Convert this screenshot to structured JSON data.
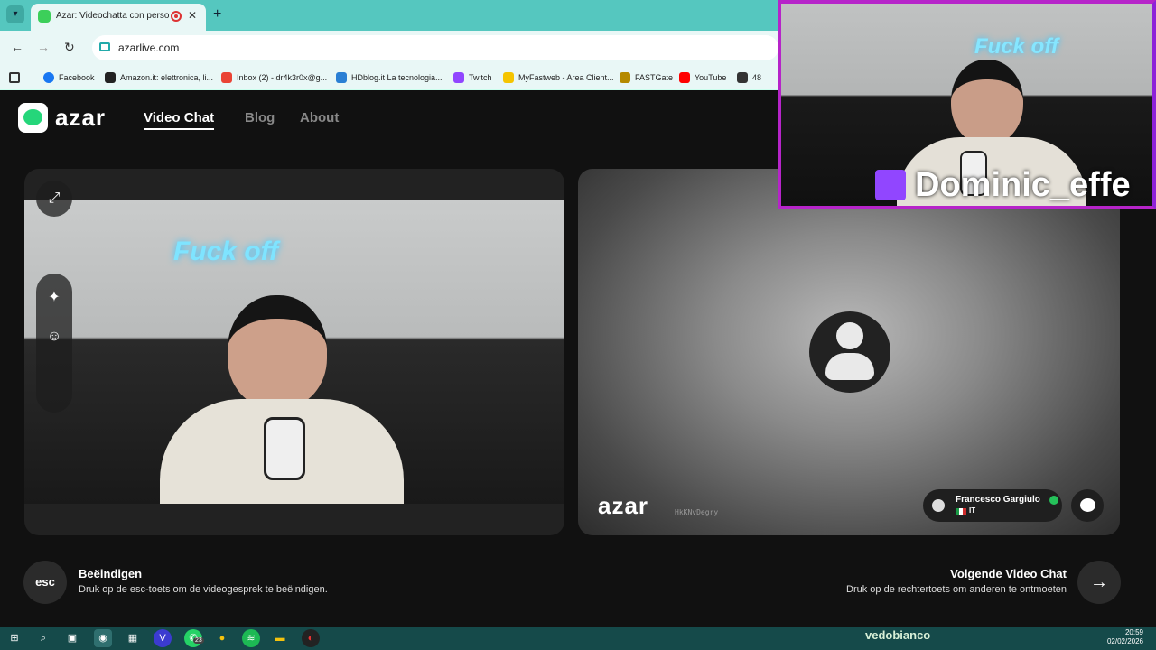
{
  "browser": {
    "tab_title": "Azar: Videochatta con persone n",
    "tab_close": "✕",
    "new_tab": "+",
    "url": "azarlive.com",
    "nav_back": "←",
    "nav_forward": "→",
    "nav_reload": "↻",
    "bookmarks": [
      {
        "label": "Facebook",
        "color": "#1877f2"
      },
      {
        "label": "Amazon.it: elettronica, li...",
        "color": "#222222"
      },
      {
        "label": "Inbox (2) - dr4k3r0x@g...",
        "color": "#ea4335"
      },
      {
        "label": "HDblog.it La tecnologia...",
        "color": "#2a7fd4"
      },
      {
        "label": "Twitch",
        "color": "#9146ff"
      },
      {
        "label": "MyFastweb - Area Client...",
        "color": "#f5c400"
      },
      {
        "label": "FASTGate",
        "color": "#b58a00"
      },
      {
        "label": "YouTube",
        "color": "#ff0000"
      },
      {
        "label": "48",
        "color": "#333333"
      }
    ]
  },
  "azar": {
    "logo_text": "azar",
    "nav": [
      "Video Chat",
      "Blog",
      "About"
    ],
    "neon_text": "Fuck off",
    "watermark": "azar",
    "peer_id": "HkKNvDegry",
    "user_name": "Francesco Gargiulo",
    "country_code": "IT",
    "end": {
      "key": "esc",
      "title": "Beëindigen",
      "description": "Druk op de esc-toets om de videogesprek te beëindigen."
    },
    "next": {
      "title": "Volgende Video Chat",
      "description": "Druk op de rechtertoets om anderen te ontmoeten",
      "arrow": "→"
    }
  },
  "overlay": {
    "neon_text": "Fuck off",
    "streamer_name": "Dominic_effe",
    "accent": "#b624c9"
  },
  "taskbar": {
    "brand_text": "vedobianco",
    "badge": "23",
    "time": "20:59",
    "date": "02/02/2026"
  }
}
